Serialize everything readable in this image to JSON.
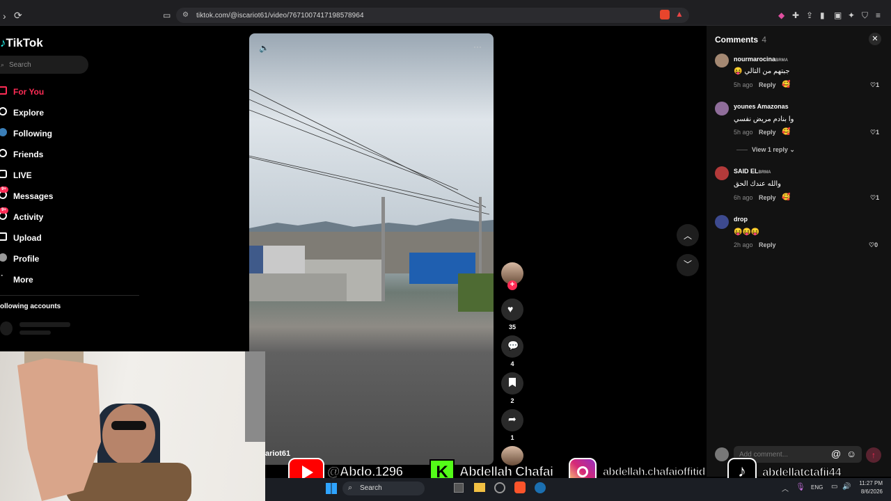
{
  "browser": {
    "url": "tiktok.com/@iscariot61/video/7671007417198578964"
  },
  "sidebar": {
    "logo": "TikTok",
    "search_placeholder": "Search",
    "nav": [
      {
        "label": "For You",
        "active": true
      },
      {
        "label": "Explore"
      },
      {
        "label": "Following"
      },
      {
        "label": "Friends"
      },
      {
        "label": "LIVE"
      },
      {
        "label": "Messages",
        "badge": "9+"
      },
      {
        "label": "Activity",
        "badge": "9+"
      },
      {
        "label": "Upload"
      },
      {
        "label": "Profile"
      },
      {
        "label": "More"
      }
    ],
    "following_accounts": "ollowing accounts"
  },
  "video": {
    "author": "ariot61",
    "likes": "35",
    "comments": "4",
    "saves": "2",
    "shares": "1"
  },
  "comments_panel": {
    "title": "Comments",
    "count": "4",
    "add_placeholder": "Add comment...",
    "items": [
      {
        "user": "nourmarocina",
        "tag": "BRMA",
        "text": "جبتهم من التالي 😝",
        "time": "5h ago",
        "reply": "Reply",
        "likes": "1"
      },
      {
        "user": "younes Amazonas",
        "tag": "",
        "text": "وا بنادم مريض نفسي",
        "time": "5h ago",
        "reply": "Reply",
        "likes": "1",
        "view_replies": "View 1 reply"
      },
      {
        "user": "SAID EL",
        "tag": "BRMA",
        "text": "والله عندك الحق",
        "time": "6h ago",
        "reply": "Reply",
        "likes": "1"
      },
      {
        "user": "drop",
        "tag": "",
        "text": "😝😝😝",
        "time": "2h ago",
        "reply": "Reply",
        "likes": "0"
      }
    ]
  },
  "promo": {
    "youtube": "@Abdo.1296",
    "kick": "Abdellah Chafai",
    "instagram": "abdellah.chafaioffitid",
    "tiktok": "abdellatctafii44"
  },
  "taskbar": {
    "search": "Search",
    "lang": "ENG",
    "time": "11:27 PM",
    "date": "8/6/2026"
  },
  "colors": {
    "accent": "#fe2c55",
    "bg": "#000000",
    "panel": "#121212"
  }
}
